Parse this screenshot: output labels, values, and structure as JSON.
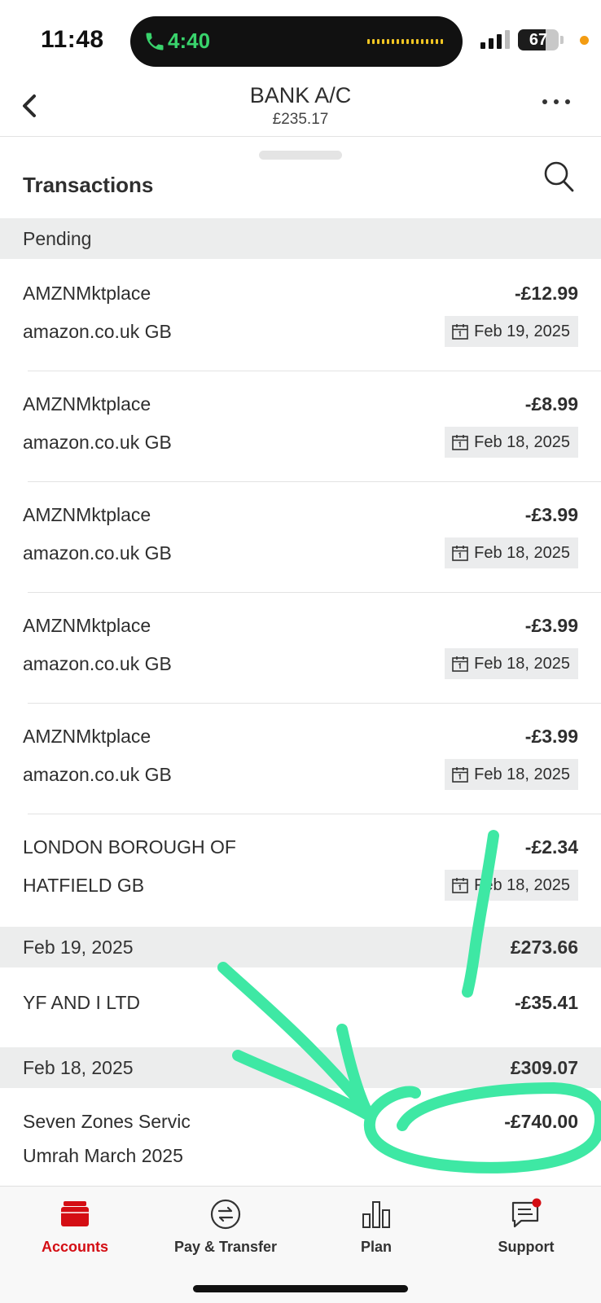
{
  "status_bar": {
    "time": "11:48",
    "call_timer": "4:40",
    "battery_level": "67",
    "battery_fraction": 0.67
  },
  "header": {
    "title": "BANK A/C",
    "balance": "£235.17"
  },
  "section": {
    "title": "Transactions"
  },
  "pending": {
    "label": "Pending",
    "transactions": [
      {
        "merchant": "AMZNMktplace",
        "detail": "amazon.co.uk GB",
        "amount": "-£12.99",
        "date": "Feb 19, 2025"
      },
      {
        "merchant": "AMZNMktplace",
        "detail": "amazon.co.uk GB",
        "amount": "-£8.99",
        "date": "Feb 18, 2025"
      },
      {
        "merchant": "AMZNMktplace",
        "detail": "amazon.co.uk GB",
        "amount": "-£3.99",
        "date": "Feb 18, 2025"
      },
      {
        "merchant": "AMZNMktplace",
        "detail": "amazon.co.uk GB",
        "amount": "-£3.99",
        "date": "Feb 18, 2025"
      },
      {
        "merchant": "AMZNMktplace",
        "detail": "amazon.co.uk GB",
        "amount": "-£3.99",
        "date": "Feb 18, 2025"
      },
      {
        "merchant": "LONDON BOROUGH OF",
        "detail": "HATFIELD GB",
        "amount": "-£2.34",
        "date": "Feb 18, 2025"
      }
    ]
  },
  "posted": [
    {
      "date": "Feb 19, 2025",
      "balance": "£273.66",
      "transactions": [
        {
          "merchant": "YF AND I LTD",
          "amount": "-£35.41"
        }
      ]
    },
    {
      "date": "Feb 18, 2025",
      "balance": "£309.07",
      "transactions": [
        {
          "merchant": "Seven Zones Servic",
          "detail": "Umrah March 2025",
          "amount": "-£740.00"
        }
      ]
    }
  ],
  "tabs": [
    {
      "label": "Accounts",
      "icon": "wallet-icon",
      "active": true
    },
    {
      "label": "Pay & Transfer",
      "icon": "transfer-icon",
      "active": false
    },
    {
      "label": "Plan",
      "icon": "bar-chart-icon",
      "active": false
    },
    {
      "label": "Support",
      "icon": "chat-icon",
      "active": false
    }
  ],
  "colors": {
    "brand_red": "#d40e14",
    "annotation_green": "#3ee8a4",
    "call_green": "#39d36c"
  }
}
